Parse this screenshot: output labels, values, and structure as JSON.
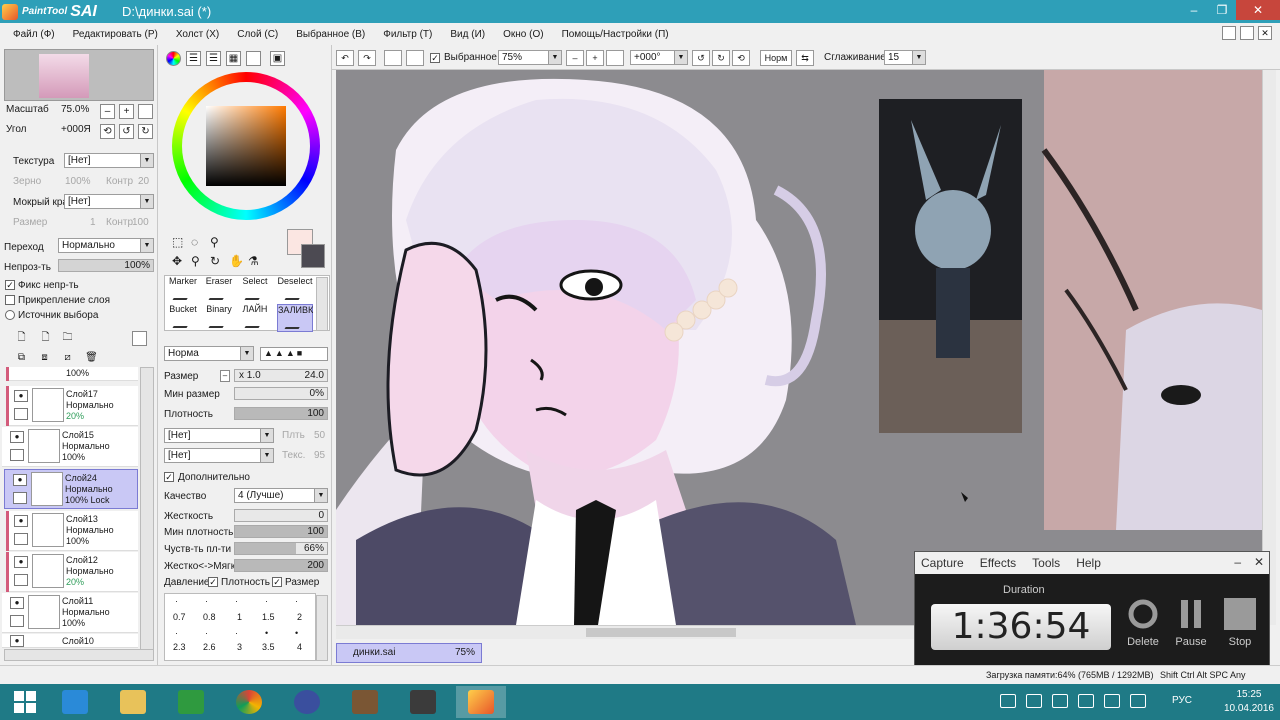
{
  "window": {
    "app_name": "PaintTool",
    "app_name_big": "SAI",
    "title": "D:\\динки.sai (*)",
    "min": "–",
    "max": "❐",
    "close": "✕"
  },
  "menu": [
    "Файл (Ф)",
    "Редактировать (Р)",
    "Холст (Х)",
    "Слой (С)",
    "Выбранное (В)",
    "Фильтр (Т)",
    "Вид (И)",
    "Окно (О)",
    "Помощь/Настройки (П)"
  ],
  "navigator": {
    "zoom_label": "Масштаб",
    "zoom_value": "75.0%",
    "angle_label": "Угол",
    "angle_value": "+000Я",
    "texture_label": "Текстура",
    "texture_value": "[Нет]",
    "grain_label": "Зерно",
    "grain_value": "100%",
    "contrast_label": "Контр",
    "contrast_value": "20",
    "wet_label": "Мокрый край",
    "wet_value": "[Нет]",
    "size_label": "Размер",
    "size_value": "1",
    "contr2_label": "Контр",
    "contr2_value": "100"
  },
  "layer_props": {
    "blend_label": "Переход",
    "blend_value": "Нормально",
    "opacity_label": "Непроз-ть",
    "opacity_value": "100%",
    "fix_label": "Фикс непр-ть",
    "clip_label": "Прикрепление слоя",
    "source_label": "Источник выбора"
  },
  "layers": [
    {
      "name": "",
      "mode": "",
      "opacity": "100%",
      "lock": ""
    },
    {
      "name": "Слой17",
      "mode": "Нормально",
      "opacity": "20%",
      "lock": ""
    },
    {
      "name": "Слой15",
      "mode": "Нормально",
      "opacity": "100%",
      "lock": ""
    },
    {
      "name": "Слой24",
      "mode": "Нормально",
      "opacity": "100%",
      "lock": "Lock"
    },
    {
      "name": "Слой13",
      "mode": "Нормально",
      "opacity": "100%",
      "lock": ""
    },
    {
      "name": "Слой12",
      "mode": "Нормально",
      "opacity": "20%",
      "lock": ""
    },
    {
      "name": "Слой11",
      "mode": "Нормально",
      "opacity": "100%",
      "lock": ""
    },
    {
      "name": "Слой10",
      "mode": "",
      "opacity": "",
      "lock": ""
    }
  ],
  "tools": {
    "items": [
      "Marker",
      "Eraser",
      "Select",
      "Deselect",
      "Bucket",
      "Binary",
      "ЛАЙН",
      "ЗАЛИВК"
    ],
    "blend_value": "Норма",
    "size_label": "Размер",
    "size_mult": "x 1.0",
    "size_value": "24.0",
    "min_size_label": "Мин размер",
    "min_size_value": "0%",
    "density_label": "Плотность",
    "density_value": "100",
    "brush_shape": "[Нет]",
    "brush_shape_param": "Плть",
    "brush_shape_value": "50",
    "brush_tex": "[Нет]",
    "brush_tex_param": "Текс.",
    "brush_tex_value": "95",
    "advanced_label": "Дополнительно",
    "quality_label": "Качество",
    "quality_value": "4 (Лучше)",
    "hardness_label": "Жесткость",
    "hardness_value": "0",
    "min_density_label": "Мин плотность",
    "min_density_value": "100",
    "sens_label": "Чуств-ть пл-ти",
    "sens_value": "66%",
    "sens_fill": 66,
    "soft_label": "Жестко<->Мягко",
    "soft_value": "200",
    "pressure_label": "Давление:",
    "pressure_density": "Плотность",
    "pressure_size": "Размер",
    "sizes_row1": [
      "0.7",
      "0.8",
      "1",
      "1.5",
      "2"
    ],
    "sizes_row2": [
      "2.3",
      "2.6",
      "3",
      "3.5",
      "4"
    ]
  },
  "canvas_toolbar": {
    "selection_label": "Выбранное",
    "zoom_value": "75%",
    "angle_value": "+000°",
    "mode_value": "Норм",
    "smoothing_label": "Сглаживание",
    "smoothing_value": "15"
  },
  "file_tab": {
    "name": "динки.sai",
    "zoom": "75%"
  },
  "timer": {
    "menu": [
      "Capture",
      "Effects",
      "Tools",
      "Help"
    ],
    "duration_label": "Duration",
    "time": "1:36:54",
    "delete_label": "Delete",
    "pause_label": "Pause",
    "stop_label": "Stop"
  },
  "status": {
    "memory": "Загрузка памяти:64% (765MB / 1292MB)",
    "keys": "Shift Ctrl Alt SPC Any"
  },
  "taskbar": {
    "lang": "РУС",
    "time": "15:25",
    "date": "10.04.2016"
  }
}
